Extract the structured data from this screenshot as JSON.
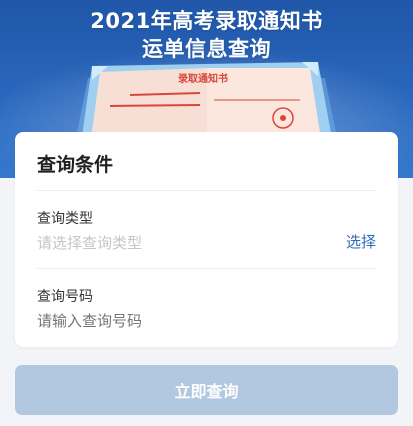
{
  "banner": {
    "title_line1": "2021年高考录取通知书",
    "title_line2": "运单信息查询",
    "letter_heading": "录取通知书"
  },
  "form": {
    "title": "查询条件",
    "query_type": {
      "label": "查询类型",
      "placeholder": "请选择查询类型",
      "action": "选择"
    },
    "query_number": {
      "label": "查询号码",
      "placeholder": "请输入查询号码"
    }
  },
  "submit": {
    "label": "立即查询"
  },
  "colors": {
    "banner": "#2a67bd",
    "accent": "#2f6db5",
    "button_disabled": "#b2c8e0",
    "letter_red": "#d9463a"
  }
}
